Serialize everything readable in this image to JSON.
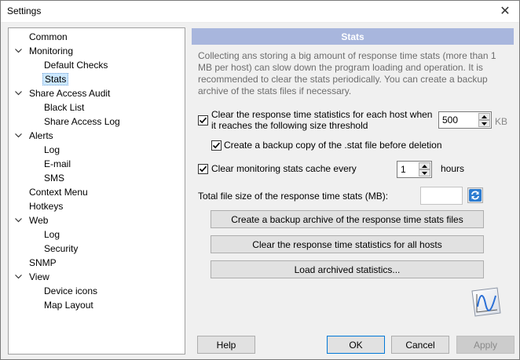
{
  "window": {
    "title": "Settings"
  },
  "tree": {
    "items": [
      {
        "label": "Common",
        "level": 0,
        "expandable": false
      },
      {
        "label": "Monitoring",
        "level": 0,
        "expandable": true
      },
      {
        "label": "Default Checks",
        "level": 1,
        "expandable": false
      },
      {
        "label": "Stats",
        "level": 1,
        "expandable": false,
        "selected": true
      },
      {
        "label": "Share Access Audit",
        "level": 0,
        "expandable": true
      },
      {
        "label": "Black List",
        "level": 1,
        "expandable": false
      },
      {
        "label": "Share Access Log",
        "level": 1,
        "expandable": false
      },
      {
        "label": "Alerts",
        "level": 0,
        "expandable": true
      },
      {
        "label": "Log",
        "level": 1,
        "expandable": false
      },
      {
        "label": "E-mail",
        "level": 1,
        "expandable": false
      },
      {
        "label": "SMS",
        "level": 1,
        "expandable": false
      },
      {
        "label": "Context Menu",
        "level": 0,
        "expandable": false
      },
      {
        "label": "Hotkeys",
        "level": 0,
        "expandable": false
      },
      {
        "label": "Web",
        "level": 0,
        "expandable": true
      },
      {
        "label": "Log",
        "level": 1,
        "expandable": false
      },
      {
        "label": "Security",
        "level": 1,
        "expandable": false
      },
      {
        "label": "SNMP",
        "level": 0,
        "expandable": false
      },
      {
        "label": "View",
        "level": 0,
        "expandable": true
      },
      {
        "label": "Device icons",
        "level": 1,
        "expandable": false
      },
      {
        "label": "Map Layout",
        "level": 1,
        "expandable": false
      }
    ]
  },
  "panel": {
    "header": "Stats",
    "description": "Collecting ans storing a big amount of response time stats (more than 1 MB per host) can slow down the program loading and operation. It is recommended to clear the stats periodically. You can create a backup archive of the stats files if necessary.",
    "clear_threshold": {
      "checked": true,
      "label_line1": "Clear the response time statistics for each host when",
      "label_line2": "it reaches the following size threshold",
      "value": "500",
      "unit": "KB"
    },
    "backup_copy": {
      "checked": true,
      "label": "Create a backup copy of the .stat file before deletion"
    },
    "clear_cache": {
      "checked": true,
      "label": "Clear monitoring stats cache every",
      "value": "1",
      "unit": "hours"
    },
    "total_size_label": "Total file size of the response time stats (MB):",
    "total_size_value": "",
    "buttons": {
      "backup_archive": "Create a backup archive of the response time stats files",
      "clear_all": "Clear the response time statistics for all hosts",
      "load_archived": "Load archived statistics..."
    }
  },
  "footer": {
    "help": "Help",
    "ok": "OK",
    "cancel": "Cancel",
    "apply": "Apply"
  },
  "icons": {
    "close": "close-icon",
    "refresh": "refresh-icon",
    "chart": "stats-chart-icon"
  }
}
